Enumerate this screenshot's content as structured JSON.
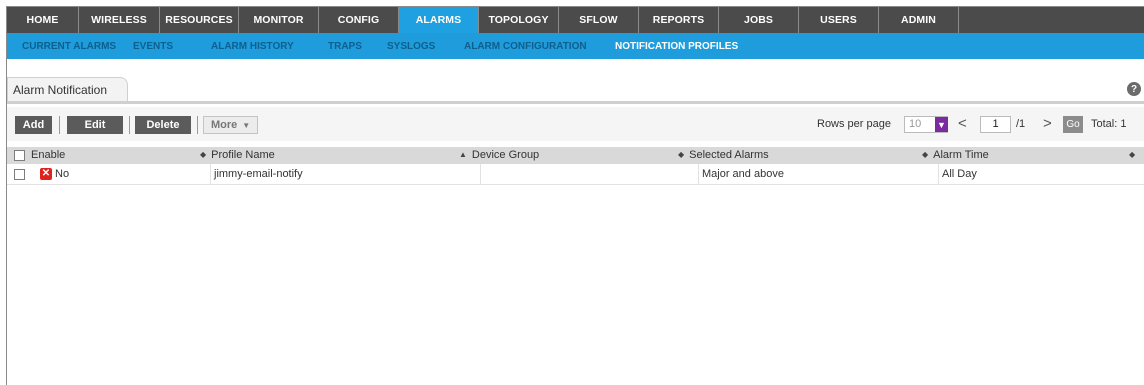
{
  "main_nav": {
    "items": [
      {
        "label": "HOME"
      },
      {
        "label": "WIRELESS"
      },
      {
        "label": "RESOURCES"
      },
      {
        "label": "MONITOR"
      },
      {
        "label": "CONFIG"
      },
      {
        "label": "ALARMS"
      },
      {
        "label": "TOPOLOGY"
      },
      {
        "label": "SFLOW"
      },
      {
        "label": "REPORTS"
      },
      {
        "label": "JOBS"
      },
      {
        "label": "USERS"
      },
      {
        "label": "ADMIN"
      }
    ],
    "active": "ALARMS"
  },
  "sub_nav": {
    "items": [
      {
        "label": "CURRENT ALARMS"
      },
      {
        "label": "EVENTS"
      },
      {
        "label": "ALARM HISTORY"
      },
      {
        "label": "TRAPS"
      },
      {
        "label": "SYSLOGS"
      },
      {
        "label": "ALARM CONFIGURATION"
      },
      {
        "label": "NOTIFICATION PROFILES"
      }
    ],
    "active": "NOTIFICATION PROFILES"
  },
  "panel": {
    "tab_label": "Alarm Notification",
    "help_icon": "?"
  },
  "toolbar": {
    "add_label": "Add",
    "edit_label": "Edit",
    "delete_label": "Delete",
    "more_label": "More",
    "more_caret": "▼",
    "rows_per_page_label": "Rows per page",
    "rows_per_page_value": "10",
    "rows_select_arrow": "▼",
    "prev_icon": "<",
    "page_value": "1",
    "page_total": "/1",
    "next_icon": ">",
    "go_label": "Go",
    "total_label": "Total: 1"
  },
  "table": {
    "sort_icon_up_down": "◆",
    "sort_icon_up": "▲",
    "columns": {
      "enable": "Enable",
      "profile_name": "Profile Name",
      "device_group": "Device Group",
      "selected_alarms": "Selected Alarms",
      "alarm_time": "Alarm Time"
    },
    "rows": [
      {
        "status_icon": "✕",
        "enable": "No",
        "profile_name": "jimmy-email-notify",
        "device_group": "",
        "selected_alarms": "Major and above",
        "alarm_time": "All Day"
      }
    ]
  },
  "colors": {
    "nav_bg": "#4b4b4b",
    "nav_active": "#1fa0e0",
    "subnav_bg": "#1f9cdb",
    "button_bg": "#5b5b5b",
    "disabled_status": "#e0221f",
    "select_accent": "#7b2aa0"
  }
}
